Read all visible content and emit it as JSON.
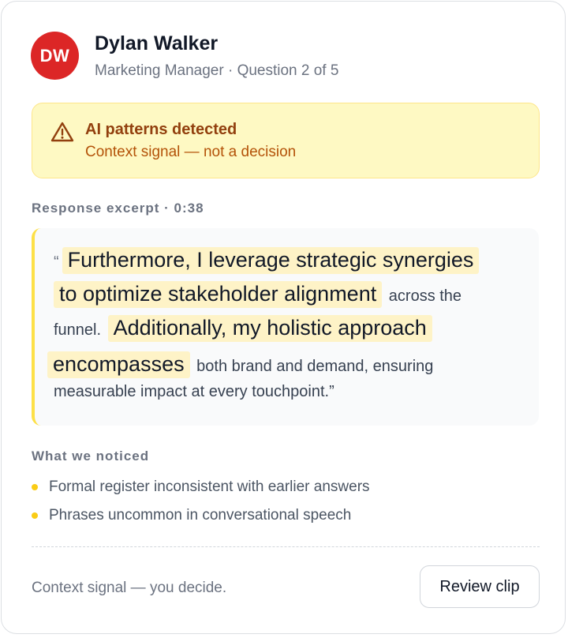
{
  "candidate": {
    "initials": "DW",
    "name": "Dylan Walker",
    "subtitle": "Marketing Manager · Question 2 of 5"
  },
  "alert": {
    "icon": "warning-triangle-icon",
    "title": "AI patterns detected",
    "subtitle": "Context signal — not a decision"
  },
  "excerpt": {
    "label": "Response excerpt · 0:38",
    "open_quote": "“",
    "segments": [
      {
        "text": "Furthermore, I leverage strategic synergies",
        "highlight": true
      },
      {
        "text": "to optimize stakeholder alignment",
        "highlight": true
      },
      {
        "text": "across the",
        "highlight": false
      },
      {
        "text": "funnel.",
        "highlight": false
      },
      {
        "text": "Additionally, my holistic approach",
        "highlight": true
      },
      {
        "text": "encompasses",
        "highlight": true
      },
      {
        "text": "both brand and demand, ensuring",
        "highlight": false
      },
      {
        "text": "measurable impact at every touchpoint.”",
        "highlight": false
      }
    ]
  },
  "noticed": {
    "label": "What we noticed",
    "items": [
      "Formal register inconsistent with earlier answers",
      "Phrases uncommon in conversational speech"
    ]
  },
  "footer": {
    "text": "Context signal — you decide.",
    "button_label": "Review clip"
  },
  "colors": {
    "avatar": "#dc2626",
    "alert_bg": "#fef9c3",
    "alert_title": "#92400e",
    "highlight": "#fef3c7",
    "bullet": "#facc15",
    "excerpt_border": "#fde047"
  }
}
